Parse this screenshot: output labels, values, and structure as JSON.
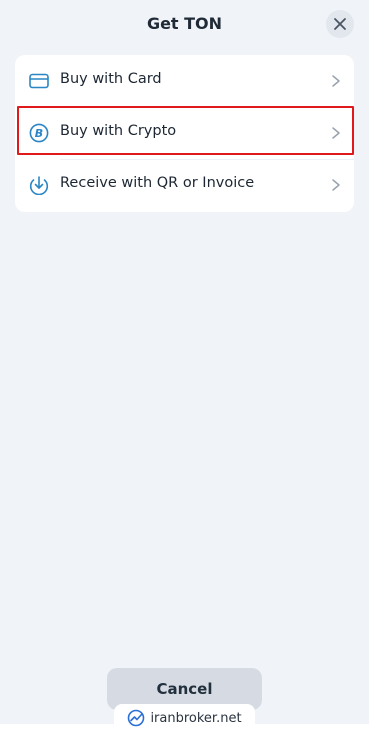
{
  "header": {
    "title": "Get TON"
  },
  "options": [
    {
      "label": "Buy with Card",
      "icon": "credit-card-icon"
    },
    {
      "label": "Buy with Crypto",
      "icon": "crypto-coin-icon"
    },
    {
      "label": "Receive with QR or Invoice",
      "icon": "download-circle-icon"
    }
  ],
  "footer": {
    "cancel_label": "Cancel"
  },
  "watermark": {
    "text": "iranbroker.net"
  },
  "colors": {
    "accent": "#2a86c4",
    "highlight": "#e0191c",
    "background": "#f0f3f8"
  }
}
